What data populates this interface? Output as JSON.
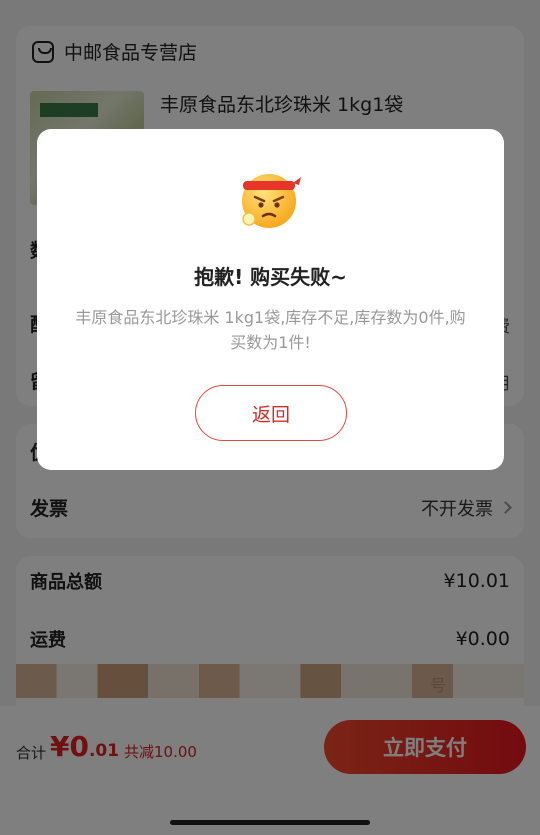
{
  "store": {
    "name": "中邮食品专营店",
    "icon": "store-icon"
  },
  "product": {
    "title": "丰原食品东北珍珠米 1kg1袋"
  },
  "partial_rows": {
    "row1_label": "数",
    "row2_label": "配",
    "row2_right": "费",
    "row3_label": "留",
    "row3_right": "用",
    "row4_label": "优"
  },
  "invoice": {
    "label": "发票",
    "value": "不开发票"
  },
  "totals": {
    "goods_label": "商品总额",
    "goods_value": "¥10.01",
    "shipping_label": "运费",
    "shipping_value": "¥0.00",
    "masked_suffix": "号"
  },
  "bottom_bar": {
    "total_label": "合计",
    "total_currency": "¥",
    "total_int": "0",
    "total_dec": ".01",
    "discount": "共减10.00",
    "pay_label": "立即支付"
  },
  "dialog": {
    "icon": "angry-face-icon",
    "title": "抱歉! 购买失败~",
    "message": "丰原食品东北珍珠米 1kg1袋,库存不足,库存数为0件,购买数为1件!",
    "button_label": "返回"
  },
  "colors": {
    "accent_red": "#e02020",
    "dialog_button_border": "#e44a3e",
    "overlay": "rgba(0,0,0,0.5)"
  }
}
